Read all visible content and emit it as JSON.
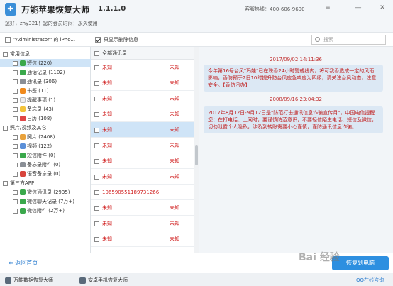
{
  "app": {
    "title": "万能苹果恢复大师",
    "version": "1.1.1.0",
    "greeting": "您好，zhy321！您的会员时间：永久使用",
    "hotline": "客服热线：400-606-9600",
    "window_controls": [
      "≡",
      "—",
      "✕"
    ]
  },
  "toolbar": {
    "device_label": "\"Administrator\" 的 iPho...",
    "only_deleted_label": "只显示删除信息",
    "search_placeholder": "搜索"
  },
  "tree": {
    "groups": [
      {
        "label": "常用信息",
        "items": [
          {
            "label": "短信 (220)",
            "icon_color": "#3aa84b",
            "icon": "message-icon"
          },
          {
            "label": "通话记录 (1102)",
            "icon_color": "#3aa84b",
            "icon": "phone-icon"
          },
          {
            "label": "通讯录 (306)",
            "icon_color": "#8a8f96",
            "icon": "contacts-icon"
          },
          {
            "label": "书签 (11)",
            "icon_color": "#f08a1c",
            "icon": "bookmark-icon"
          },
          {
            "label": "提醒事项 (1)",
            "icon_color": "#eeeeee",
            "icon": "reminder-icon"
          },
          {
            "label": "备忘录 (43)",
            "icon_color": "#f3c33a",
            "icon": "notes-icon"
          },
          {
            "label": "日历 (108)",
            "icon_color": "#e04545",
            "icon": "calendar-icon"
          }
        ]
      },
      {
        "label": "照片/视频及其它",
        "items": [
          {
            "label": "照片 (2408)",
            "icon_color": "#e9a23b",
            "icon": "photos-icon"
          },
          {
            "label": "视频 (122)",
            "icon_color": "#5a8fd8",
            "icon": "video-icon"
          },
          {
            "label": "短信附件 (0)",
            "icon_color": "#3aa84b",
            "icon": "attachment-icon"
          },
          {
            "label": "备忘录附件 (0)",
            "icon_color": "#8a8f96",
            "icon": "notes-attachment-icon"
          },
          {
            "label": "语音备忘录 (0)",
            "icon_color": "#d8443c",
            "icon": "voice-memo-icon"
          }
        ]
      },
      {
        "label": "第三方APP",
        "items": [
          {
            "label": "微信通讯录 (2935)",
            "icon_color": "#3aa84b",
            "icon": "wechat-contacts-icon"
          },
          {
            "label": "微信聊天记录 (7万+)",
            "icon_color": "#3aa84b",
            "icon": "wechat-chat-icon"
          },
          {
            "label": "微信附件 (2万+)",
            "icon_color": "#3aa84b",
            "icon": "wechat-attachment-icon"
          }
        ]
      }
    ]
  },
  "messages_list": {
    "header": "全部通讯录",
    "rows": [
      {
        "name": "未知",
        "col2": "未知"
      },
      {
        "name": "未知",
        "col2": "未知"
      },
      {
        "name": "未知",
        "col2": "未知"
      },
      {
        "name": "未知",
        "col2": "未知"
      },
      {
        "name": "未知",
        "col2": "未知"
      },
      {
        "name": "未知",
        "col2": "未知"
      },
      {
        "name": "未知",
        "col2": "未知"
      },
      {
        "name": "未知",
        "col2": "未知"
      },
      {
        "name": "10659055118973126​6",
        "col2": ""
      },
      {
        "name": "未知",
        "col2": "未知"
      },
      {
        "name": "未知",
        "col2": "未知"
      },
      {
        "name": "未知",
        "col2": "未知"
      }
    ]
  },
  "conversation": {
    "entries": [
      {
        "time": "2017/09/02 14:11:36",
        "text": "今年第16号台风\"玛娃\"已在珠香24小时警戒线内，将可我香造成一定的风雨影响，香防预于2日10时提升防台风应急响应为四级，请关注台风动态，注意安全。【香防汛办】"
      },
      {
        "time": "2008/09/16 23:04:32",
        "text": "2017年8月12日-9月12日是\"防范打击通讯信息诈骗宣传月\"，中国电信提醒您：在打电话、上网时，要谨慎防范意识，不要轻信陌生电话、短信及微信，切勿泄露个人隐私，涉及到转账需要小心谨慎，谨防通讯信息诈骗。"
      }
    ]
  },
  "footer": {
    "back_label": "返回首页",
    "recover_label": "恢复到电脑"
  },
  "statusbar": {
    "item1": "万能数据恢复大师",
    "item2": "安卓手机恢复大师",
    "qq": "QQ在线咨询"
  },
  "watermark": "Bai 经验"
}
